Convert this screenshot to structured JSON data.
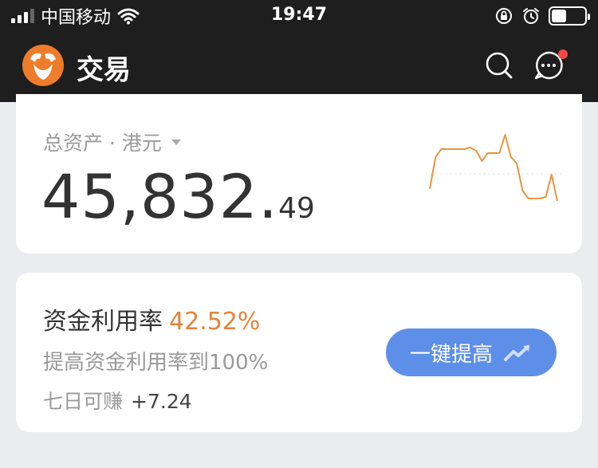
{
  "status_bar": {
    "carrier": "中国移动",
    "time": "19:47",
    "icons": [
      "signal-icon",
      "wifi-icon",
      "rotation-lock-icon",
      "alarm-icon",
      "battery-icon"
    ],
    "battery_level": 0.45
  },
  "nav": {
    "title": "交易",
    "icons": [
      "app-logo-icon",
      "search-icon",
      "message-icon"
    ],
    "has_notification": true
  },
  "assets": {
    "label": "总资产 · 港元",
    "value_int": "45,832.",
    "value_dec": "49",
    "trend_color": "#e8943f",
    "trend_points": [
      0.3,
      0.7,
      0.8,
      0.8,
      0.8,
      0.8,
      0.8,
      0.82,
      0.78,
      0.65,
      0.75,
      0.75,
      0.75,
      0.98,
      0.7,
      0.62,
      0.28,
      0.18,
      0.18,
      0.18,
      0.2,
      0.48,
      0.15
    ]
  },
  "utilization": {
    "title": "资金利用率",
    "percent": "42.52%",
    "subtitle": "提高资金利用率到100%",
    "week_label": "七日可赚",
    "week_gain": "+7.24",
    "button_label": "一键提高",
    "accent_color": "#e5833a",
    "button_color": "#5e8fe8"
  }
}
